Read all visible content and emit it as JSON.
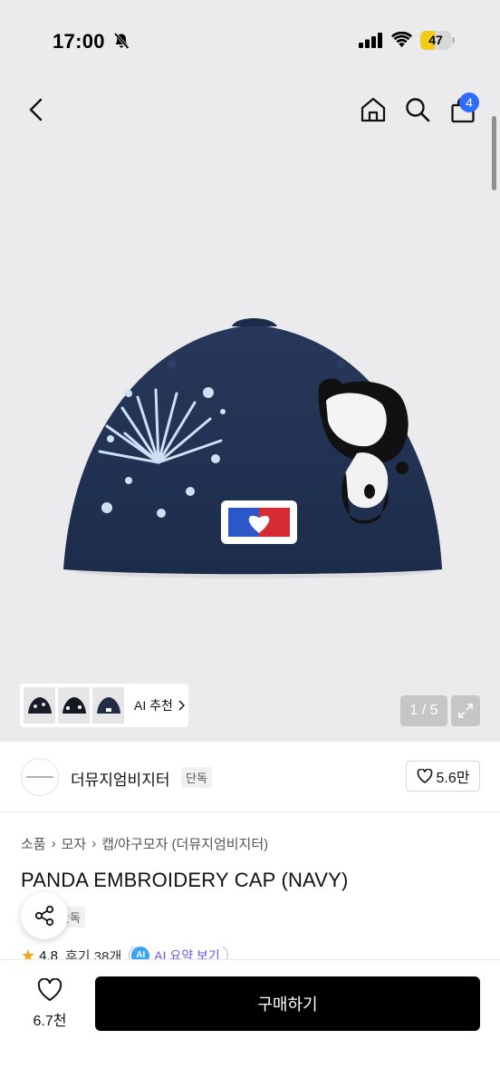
{
  "status_bar": {
    "time": "17:00",
    "battery": "47",
    "battery_level": 0.47,
    "battery_color": "#f2cc1d"
  },
  "nav": {
    "back_icon": "chevron-left-icon",
    "home_icon": "home-icon",
    "search_icon": "search-icon",
    "cart_icon": "shopping-bag-icon",
    "cart_count": "4",
    "badge_color": "#2f6bff"
  },
  "gallery": {
    "ai_recommend_label": "AI 추천",
    "pager": "1 / 5",
    "thumbnail_count": 3
  },
  "brand": {
    "name": "더뮤지엄비지터",
    "exclusive": "단독",
    "likes": "5.6만"
  },
  "breadcrumb": [
    "소품",
    "모자",
    "캡/야구모자 (더뮤지엄비지터)"
  ],
  "product": {
    "title": "PANDA EMBROIDERY CAP (NAVY)",
    "exclusive": "단독",
    "rating": "4.8",
    "reviews": "후기 38개",
    "ai_badge": "AI",
    "ai_summary": "AI 요약 보기"
  },
  "bottom_bar": {
    "wish_count": "6.7천",
    "buy_label": "구매하기"
  }
}
